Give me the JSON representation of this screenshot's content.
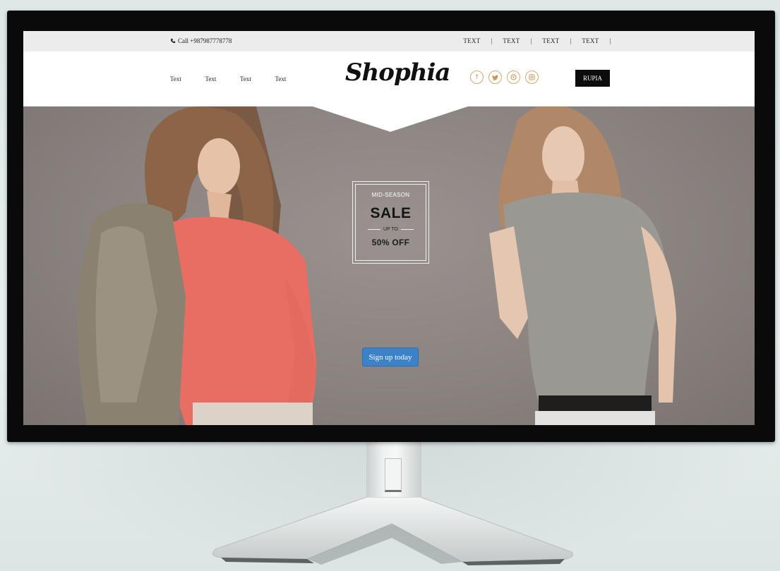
{
  "topbar": {
    "call_text": "Call +987987778778",
    "nav": [
      {
        "label": "TEXT"
      },
      {
        "label": "TEXT"
      },
      {
        "label": "TEXT"
      },
      {
        "label": "TEXT"
      }
    ],
    "separator": "|"
  },
  "header": {
    "logo": "Shophia",
    "nav": [
      {
        "label": "Text"
      },
      {
        "label": "Text"
      },
      {
        "label": "Text"
      },
      {
        "label": "Text"
      }
    ],
    "social_icons": [
      "facebook-icon",
      "twitter-icon",
      "pinterest-icon",
      "instagram-icon"
    ],
    "currency_button": "RUPIA"
  },
  "hero": {
    "sale_small": "MID-SEASON",
    "sale_big": "SALE",
    "sale_upto": "UP TO",
    "sale_off": "50% OFF",
    "cta_label": "Sign up today"
  },
  "colors": {
    "accent_gold": "#d7a86e",
    "cta_blue": "#3c82c9",
    "topbar_bg": "#ececec",
    "hero_bg": "#8a8380"
  }
}
